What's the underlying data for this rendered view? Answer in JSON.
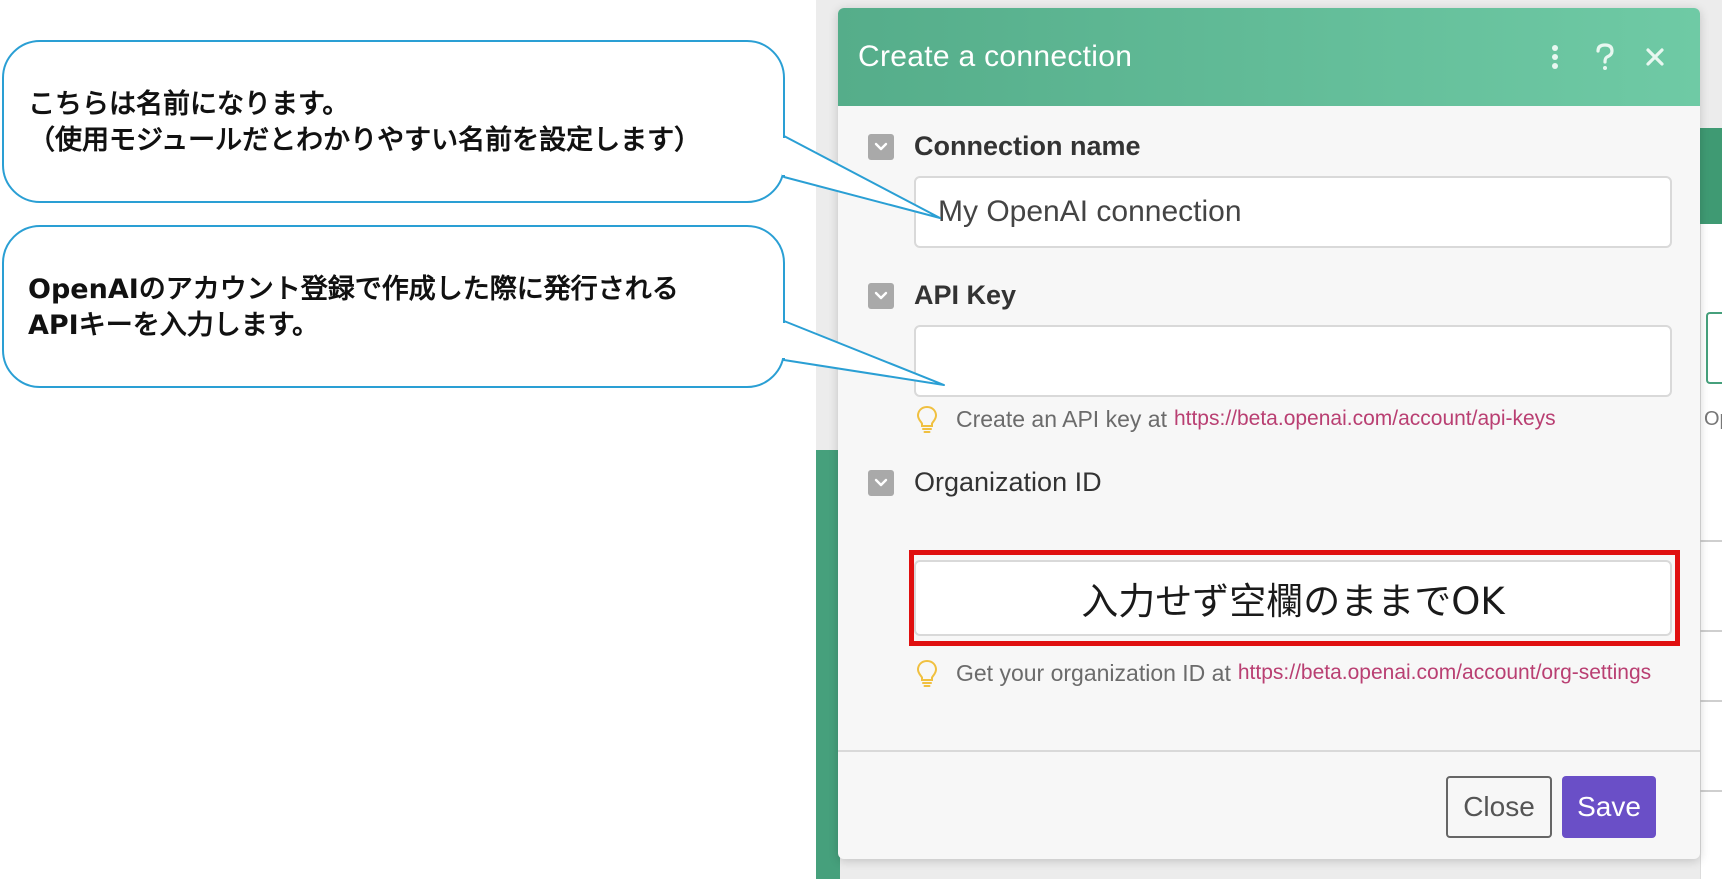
{
  "callouts": [
    {
      "lines": [
        "こちらは名前になります。",
        "（使用モジュールだとわかりやすい名前を設定します）"
      ]
    },
    {
      "lines": [
        "OpenAIのアカウント登録で作成した際に発行される",
        "APIキーを入力します。"
      ]
    }
  ],
  "modal": {
    "title": "Create a connection",
    "header_icons": [
      "more-vertical-icon",
      "help-icon",
      "close-icon"
    ],
    "fields": {
      "connection_name": {
        "label": "Connection name",
        "value": "My OpenAI connection"
      },
      "api_key": {
        "label": "API Key",
        "value": "",
        "hint_text": "Create an API key at",
        "hint_link": "https://beta.openai.com/account/api-keys"
      },
      "organization_id": {
        "label": "Organization ID",
        "annotation": "入力せず空欄のままでOK",
        "hint_text": "Get your organization ID at",
        "hint_link": "https://beta.openai.com/account/org-settings"
      }
    },
    "buttons": {
      "close": "Close",
      "save": "Save"
    }
  },
  "background": {
    "right_panel_text": "Op"
  },
  "colors": {
    "header_start": "#55ad8a",
    "header_end": "#6fcaa5",
    "save_button": "#6a4fc7",
    "link": "#b93f72",
    "highlight_border": "#e01010",
    "callout_border": "#2a9fd4"
  }
}
